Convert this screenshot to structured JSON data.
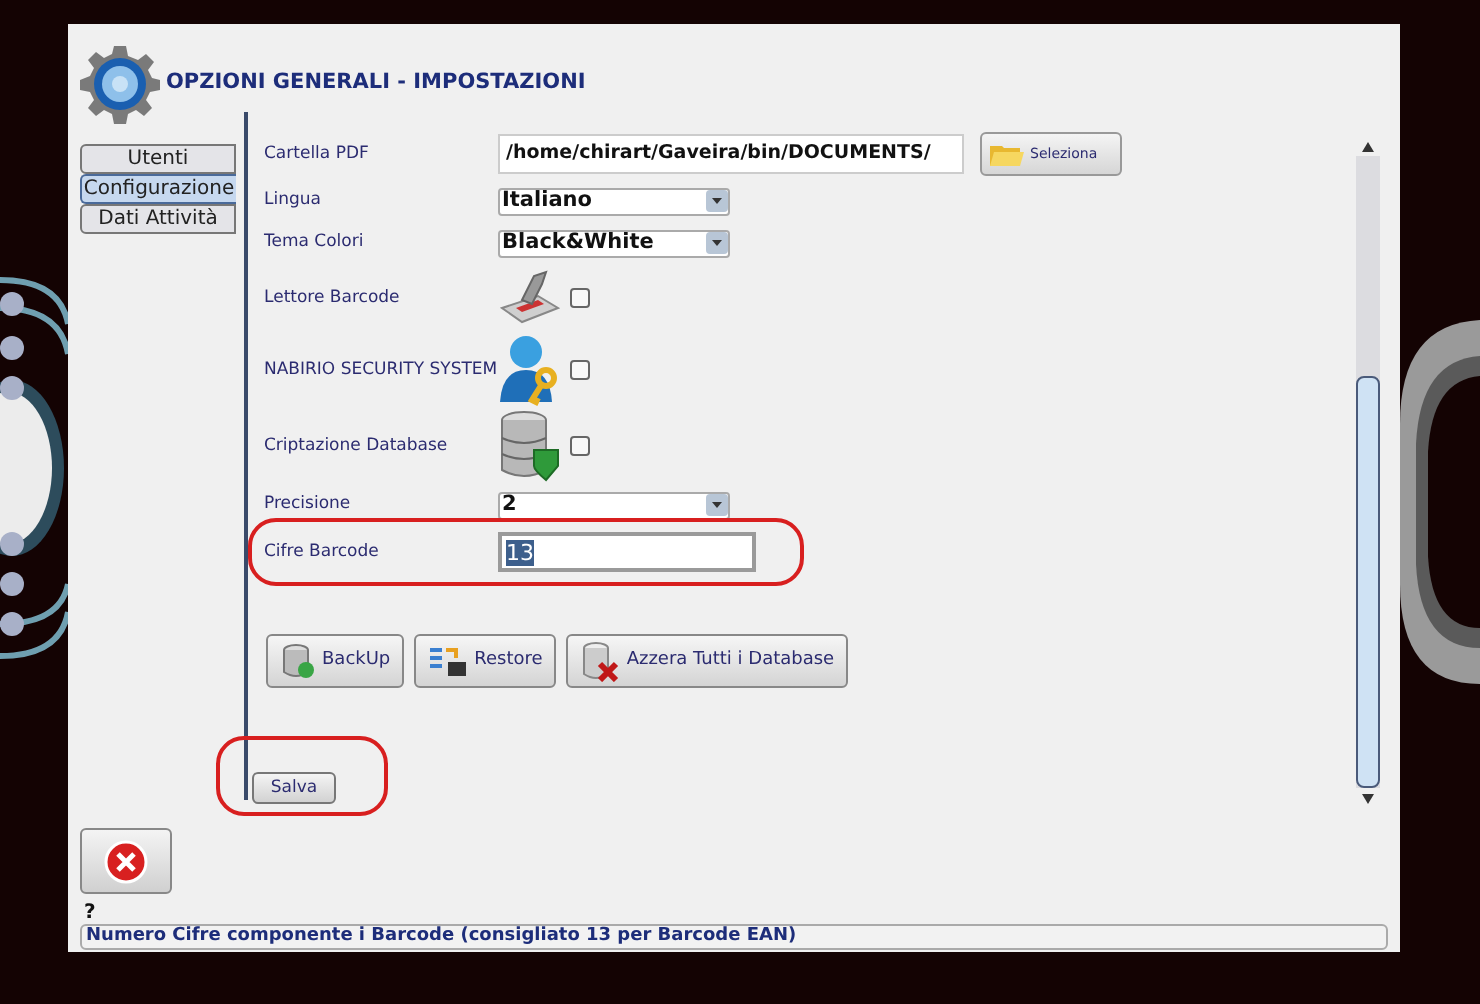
{
  "window": {
    "title": "OPZIONI GENERALI - IMPOSTAZIONI"
  },
  "tabs": [
    {
      "label": "Utenti",
      "selected": false
    },
    {
      "label": "Configurazione",
      "selected": true
    },
    {
      "label": "Dati Attività",
      "selected": false
    }
  ],
  "settings": [
    {
      "kind": "path",
      "label": "Cartella PDF",
      "value": "/home/chirart/Gaveira/bin/DOCUMENTS/",
      "button": "Seleziona"
    },
    {
      "kind": "select",
      "label": "Lingua",
      "value": "Italiano"
    },
    {
      "kind": "select",
      "label": "Tema Colori",
      "value": "Black&White"
    },
    {
      "kind": "checkbox",
      "label": "Lettore Barcode",
      "checked": false
    },
    {
      "kind": "checkbox",
      "label": "NABIRIO SECURITY SYSTEM",
      "checked": false
    },
    {
      "kind": "checkbox",
      "label": "Criptazione Database",
      "checked": false
    },
    {
      "kind": "select",
      "label": "Precisione",
      "value": "2"
    },
    {
      "kind": "text",
      "label": "Cifre Barcode",
      "value": "13",
      "text_selected": true,
      "annotated": true
    }
  ],
  "actions": [
    "BackUp",
    "Restore",
    "Azzera Tutti i Database"
  ],
  "save_button": {
    "label": "Salva",
    "annotated": true
  },
  "status_bar": {
    "help": "?",
    "message": "Numero Cifre componente i Barcode (consigliato 13 per Barcode EAN)"
  }
}
